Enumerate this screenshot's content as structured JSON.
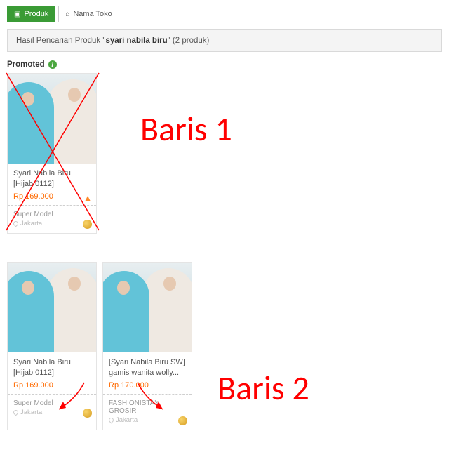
{
  "tabs": {
    "product": "Produk",
    "store": "Nama Toko"
  },
  "search": {
    "prefix": "Hasil Pencarian Produk \"",
    "query": "syari nabila biru",
    "suffix": "\" (2 produk)"
  },
  "promoted_label": "Promoted",
  "rows": [
    {
      "annotation": "Baris 1",
      "cards": [
        {
          "title": "Syari Nabila Biru [Hijab 0112]",
          "price": "Rp 169.000",
          "seller": "Super Model",
          "location": "Jakarta",
          "has_flame": true,
          "has_gold": true
        }
      ]
    },
    {
      "annotation": "Baris 2",
      "cards": [
        {
          "title": "Syari Nabila Biru [Hijab 0112]",
          "price": "Rp 169.000",
          "seller": "Super Model",
          "location": "Jakarta",
          "has_flame": false,
          "has_gold": true
        },
        {
          "title": "[Syari Nabila Biru SW] gamis wanita wolly...",
          "price": "Rp 170.000",
          "seller": "FASHIONISTA's GROSIR",
          "location": "Jakarta",
          "has_flame": false,
          "has_gold": true
        }
      ]
    }
  ]
}
